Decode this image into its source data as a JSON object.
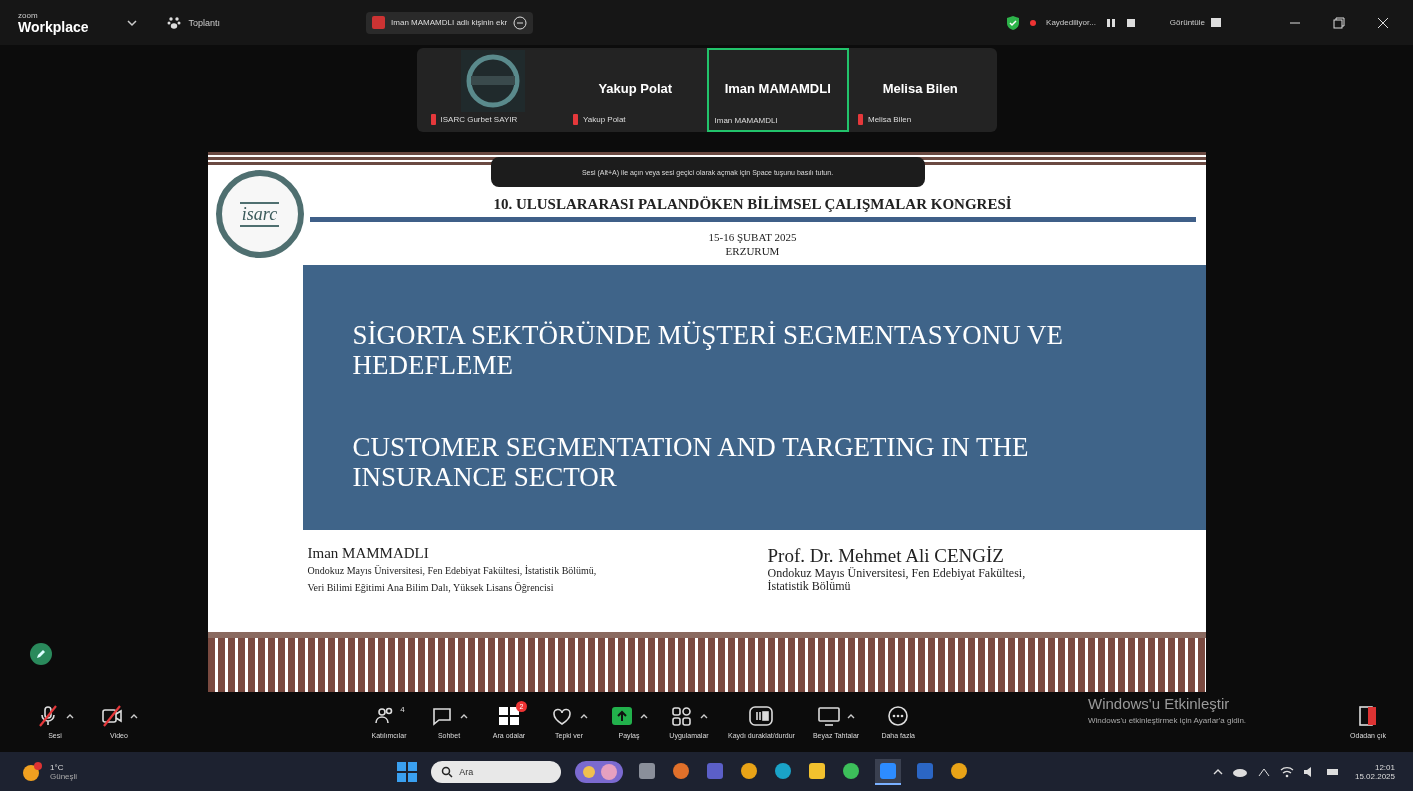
{
  "app_bar": {
    "logo_small": "zoom",
    "logo": "Workplace",
    "meeting_menu": "Toplantı",
    "share_banner": "Iman MAMAMDLI adlı kişinin ekr",
    "recording": "Kaydediliyor...",
    "view": "Görüntüle"
  },
  "participants": [
    {
      "kind": "logo",
      "name": "ISARC Gurbet SAYIR",
      "muted": true,
      "active_speaker": false
    },
    {
      "kind": "name",
      "title": "Yakup Polat",
      "name": "Yakup Polat",
      "muted": true,
      "active_speaker": false
    },
    {
      "kind": "name",
      "title": "Iman MAMAMDLI",
      "name": "Iman MAMAMDLI",
      "muted": false,
      "active_speaker": true
    },
    {
      "kind": "name",
      "title": "Melisa Bilen",
      "name": "Melisa Bilen",
      "muted": true,
      "active_speaker": false
    }
  ],
  "tooltip": "Sesi (Alt+A) ile açın veya sesi geçici olarak açmak için Space tuşunu basılı tutun.",
  "slide": {
    "logo_text": "isarc",
    "congress": "10. ULUSLARARASI PALANDÖKEN BİLİMSEL ÇALIŞMALAR KONGRESİ",
    "date": "15-16 ŞUBAT 2025",
    "city": "ERZURUM",
    "title_tr": "SİGORTA SEKTÖRÜNDE MÜŞTERİ SEGMENTASYONU VE HEDEFLEME",
    "title_en": "CUSTOMER SEGMENTATION AND TARGETING IN THE INSURANCE SECTOR",
    "authors": [
      {
        "name": "Iman MAMMADLI",
        "affiliation": [
          "Ondokuz Mayıs Üniversitesi, Fen Edebiyat Fakültesi, İstatistik Bölümü,",
          "Veri Bilimi Eğitimi Ana Bilim Dalı, Yüksek Lisans Öğrencisi"
        ]
      },
      {
        "name": "Prof. Dr. Mehmet Ali CENGİZ",
        "affiliation": [
          "Ondokuz Mayıs Üniversitesi, Fen Edebiyat Fakültesi,",
          "İstatistik Bölümü"
        ]
      }
    ]
  },
  "activation": {
    "title": "Windows'u Etkinleştir",
    "hint": "Windows'u etkinleştirmek için Ayarlar'a gidin."
  },
  "toolbar": {
    "left": [
      {
        "kind": "mic",
        "label": "Sesi",
        "off": true,
        "caret": true
      },
      {
        "kind": "video",
        "label": "Video",
        "off": true,
        "caret": true
      }
    ],
    "center": [
      {
        "kind": "people",
        "label": "Katılımcılar",
        "off": false,
        "caret": false,
        "badge": "4"
      },
      {
        "kind": "chat",
        "label": "Sohbet",
        "off": false,
        "caret": true
      },
      {
        "kind": "rooms",
        "label": "Ara odalar",
        "off": false,
        "caret": false,
        "badge": "2"
      },
      {
        "kind": "heart",
        "label": "Tepki ver",
        "off": false,
        "caret": true
      },
      {
        "kind": "share",
        "label": "Paylaş",
        "off": false,
        "caret": true
      },
      {
        "kind": "apps",
        "label": "Uygulamalar",
        "off": false,
        "caret": true
      },
      {
        "kind": "record",
        "label": "Kaydı duraklat/durdur",
        "off": false,
        "caret": false
      },
      {
        "kind": "board",
        "label": "Beyaz Tahtalar",
        "off": false,
        "caret": true
      },
      {
        "kind": "more",
        "label": "Daha fazla",
        "off": false,
        "caret": false
      }
    ],
    "right": [
      {
        "kind": "leave",
        "label": "Odadan çık",
        "off": false,
        "caret": false
      }
    ]
  },
  "taskbar": {
    "temperature": "1°C",
    "weather": "Güneşli",
    "search_placeholder": "Ara",
    "apps": [
      {
        "kind": "files",
        "active": false
      },
      {
        "kind": "copilot",
        "active": false
      },
      {
        "kind": "teams",
        "active": false
      },
      {
        "kind": "chrome",
        "active": false
      },
      {
        "kind": "edge",
        "active": false
      },
      {
        "kind": "folder",
        "active": false
      },
      {
        "kind": "whatsapp",
        "active": false
      },
      {
        "kind": "zoom",
        "active": true
      },
      {
        "kind": "word",
        "active": false
      },
      {
        "kind": "chrome",
        "active": false
      }
    ],
    "time": "12:01",
    "date": "15.02.2025"
  }
}
